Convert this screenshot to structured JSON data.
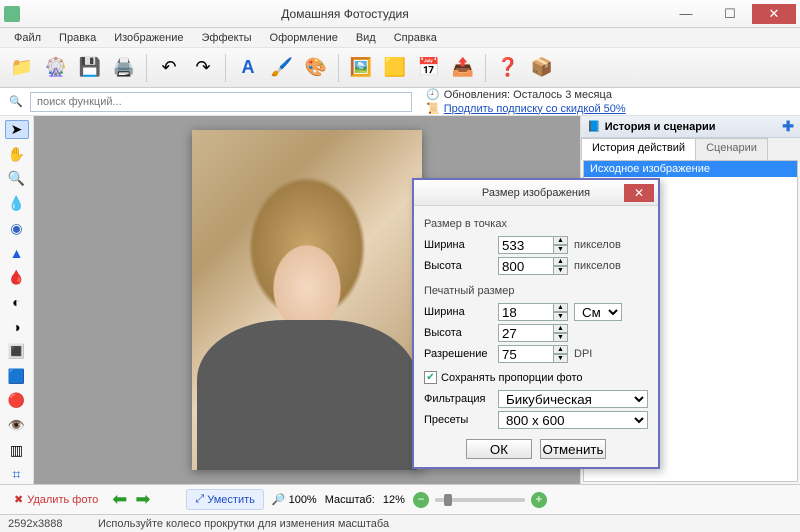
{
  "app": {
    "title": "Домашняя Фотостудия"
  },
  "menu": [
    "Файл",
    "Правка",
    "Изображение",
    "Эффекты",
    "Оформление",
    "Вид",
    "Справка"
  ],
  "toolbar_icons": [
    "open",
    "effects-wheel",
    "save",
    "print",
    "undo",
    "redo",
    "text",
    "brush",
    "palette",
    "image",
    "frame",
    "calendar",
    "share",
    "help",
    "home"
  ],
  "search": {
    "placeholder": "поиск функций..."
  },
  "updates": {
    "line1_prefix": "Обновления: ",
    "line1_rest": "Осталось  3 месяца",
    "line2": "Продлить подписку со скидкой 50%"
  },
  "left_tools": [
    "pointer",
    "hand",
    "zoom",
    "eyedrop",
    "blur-drop",
    "sharpen",
    "color-drop",
    "dodge",
    "contrast",
    "gradient",
    "levels",
    "color-swap",
    "red-eye",
    "stamp",
    "crop"
  ],
  "right_panel": {
    "title": "История и сценарии",
    "tabs": [
      "История действий",
      "Сценарии"
    ],
    "history": [
      "Исходное изображение"
    ]
  },
  "dialog": {
    "title": "Размер изображения",
    "pixel_size_label": "Размер в точках",
    "width_label": "Ширина",
    "height_label": "Высота",
    "width_px": "533",
    "height_px": "800",
    "px_unit": "пикселов",
    "print_size_label": "Печатный размер",
    "width_cm": "18",
    "height_cm": "27",
    "cm_unit": "См",
    "resolution_label": "Разрешение",
    "resolution": "75",
    "dpi_unit": "DPI",
    "keep_ratio": "Сохранять пропорции фото",
    "filter_label": "Фильтрация",
    "filter_value": "Бикубическая",
    "presets_label": "Пресеты",
    "presets_value": "800 x 600",
    "ok": "ОК",
    "cancel": "Отменить"
  },
  "bottom": {
    "delete": "Удалить фото",
    "fit": "Уместить",
    "zoom100": "100%",
    "scale_label": "Масштаб:",
    "scale_value": "12%"
  },
  "status": {
    "dimensions": "2592x3888",
    "hint": "Используйте колесо прокрутки для изменения масштаба"
  }
}
